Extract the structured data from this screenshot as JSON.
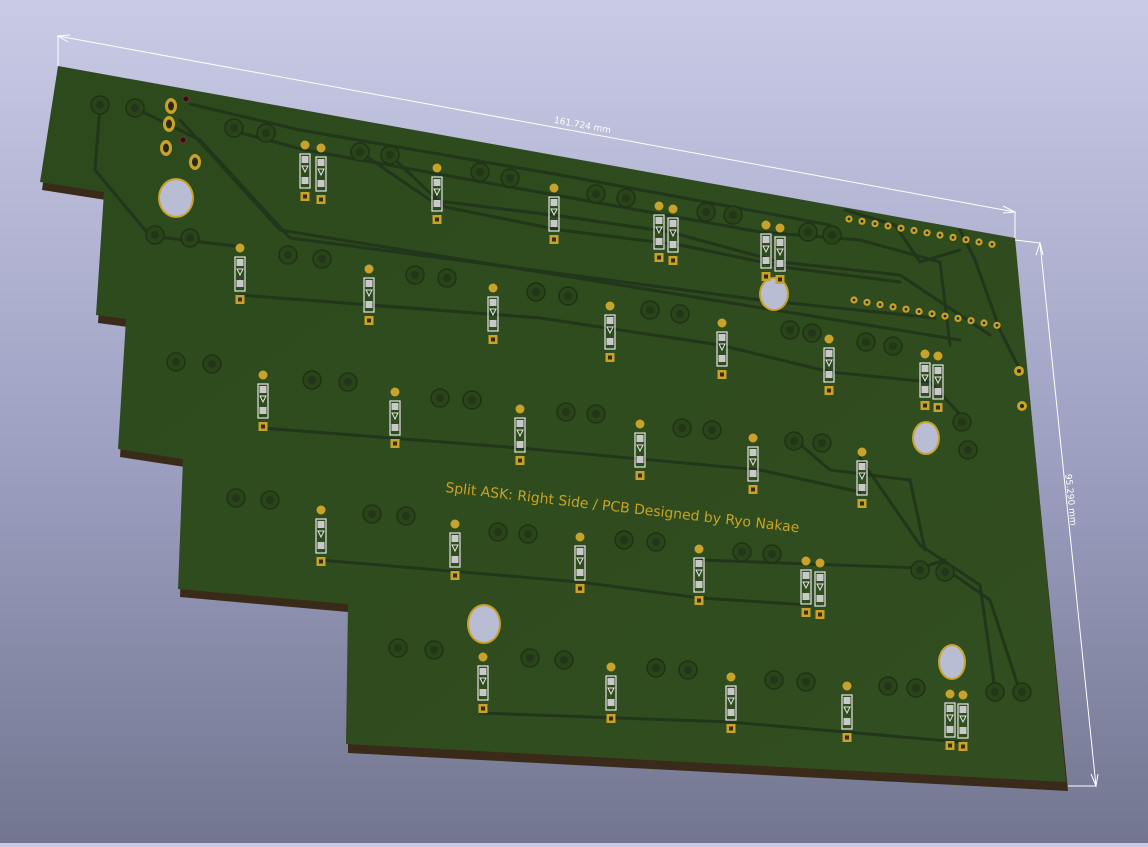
{
  "viewer": {
    "board_text": "Split ASK: Right Side / PCB Designed by Ryo Nakae",
    "dimension_width": "161.724 mm",
    "dimension_height": "95.290 mm"
  },
  "colors": {
    "background_top": "#c9cbe6",
    "background_bottom": "#72768f",
    "board": "#2f4a1e",
    "board_edge": "#3a2a1a",
    "trace": "#21361a",
    "copper": "#c8a22a",
    "silkscreen": "#d9d9d9",
    "text": "#c9a227"
  }
}
